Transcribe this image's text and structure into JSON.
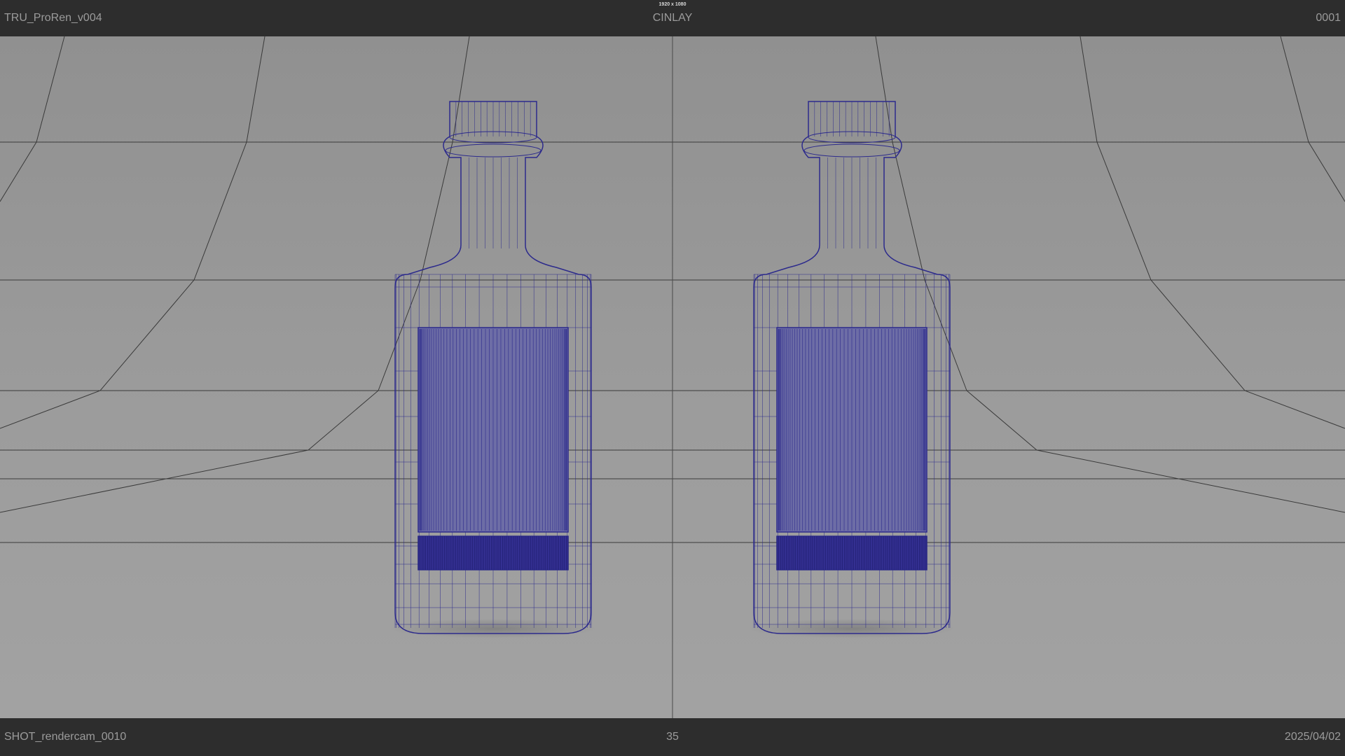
{
  "viewport": {
    "resolution_gate_label": "1920 x 1080",
    "background_color": "#9a9a9a",
    "wireframe_color": "#2c2a8c",
    "grid_line_color": "#3a3a3a"
  },
  "hud": {
    "top_left": "TRU_ProRen_v004",
    "top_center": "CINLAY",
    "top_right": "0001",
    "bottom_left": "SHOT_rendercam_0010",
    "bottom_center": "35",
    "bottom_right": "2025/04/02",
    "bar_color": "#2d2d2d",
    "text_color": "#9b9b9b"
  },
  "scene": {
    "objects": [
      {
        "name": "bottle-left"
      },
      {
        "name": "bottle-right"
      }
    ]
  }
}
